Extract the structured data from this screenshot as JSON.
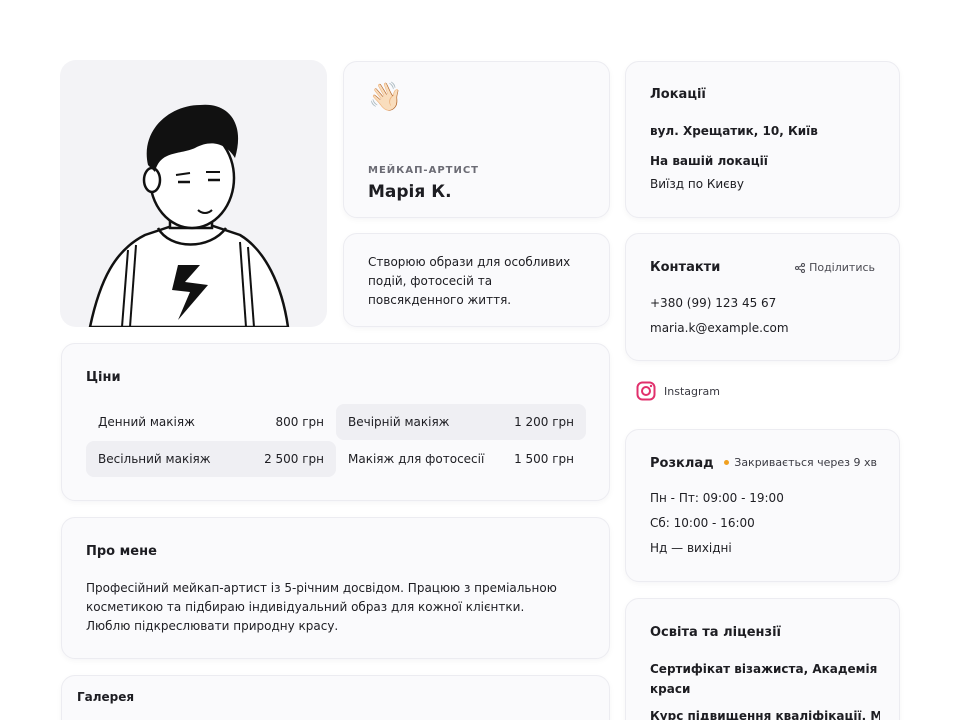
{
  "profile": {
    "role": "МЕЙКАП-АРТИСТ",
    "name": "Марія К.",
    "wave_emoji": "👋🏻",
    "bio": "Створюю образи для особливих подій, фотосесій та повсякденного життя."
  },
  "prices": {
    "title": "Ціни",
    "items": [
      {
        "label": "Денний макіяж",
        "value": "800 грн"
      },
      {
        "label": "Вечірній макіяж",
        "value": "1 200 грн"
      },
      {
        "label": "Весільний макіяж",
        "value": "2 500 грн"
      },
      {
        "label": "Макіяж для фотосесії",
        "value": "1 500 грн"
      }
    ]
  },
  "about": {
    "title": "Про мене",
    "text": "Професійний мейкап-артист із 5-річним досвідом. Працюю з преміальною косметикою та підбираю індивідуальний образ для кожної клієнтки. Люблю підкреслювати природну красу."
  },
  "gallery": {
    "title": "Галерея"
  },
  "locations": {
    "title": "Локації",
    "address": "вул. Хрещатик, 10, Київ",
    "your_location": "На вашій локації",
    "travel": "Виїзд по Києву"
  },
  "contacts": {
    "title": "Контакти",
    "share_label": "Поділитись",
    "phone": "+380 (99) 123 45 67",
    "email": "maria.k@example.com"
  },
  "instagram": {
    "label": "Instagram",
    "color": "#e1306c"
  },
  "schedule": {
    "title": "Розклад",
    "status": "Закривається через 9 хв",
    "status_color": "#f0a020",
    "rows": [
      "Пн - Пт: 09:00 - 19:00",
      "Сб: 10:00 - 16:00",
      "Нд — вихідні"
    ]
  },
  "education": {
    "title": "Освіта та ліцензії",
    "items": [
      "Сертифікат візажиста, Академія краси",
      "Курс підвищення кваліфікації, Make"
    ]
  }
}
